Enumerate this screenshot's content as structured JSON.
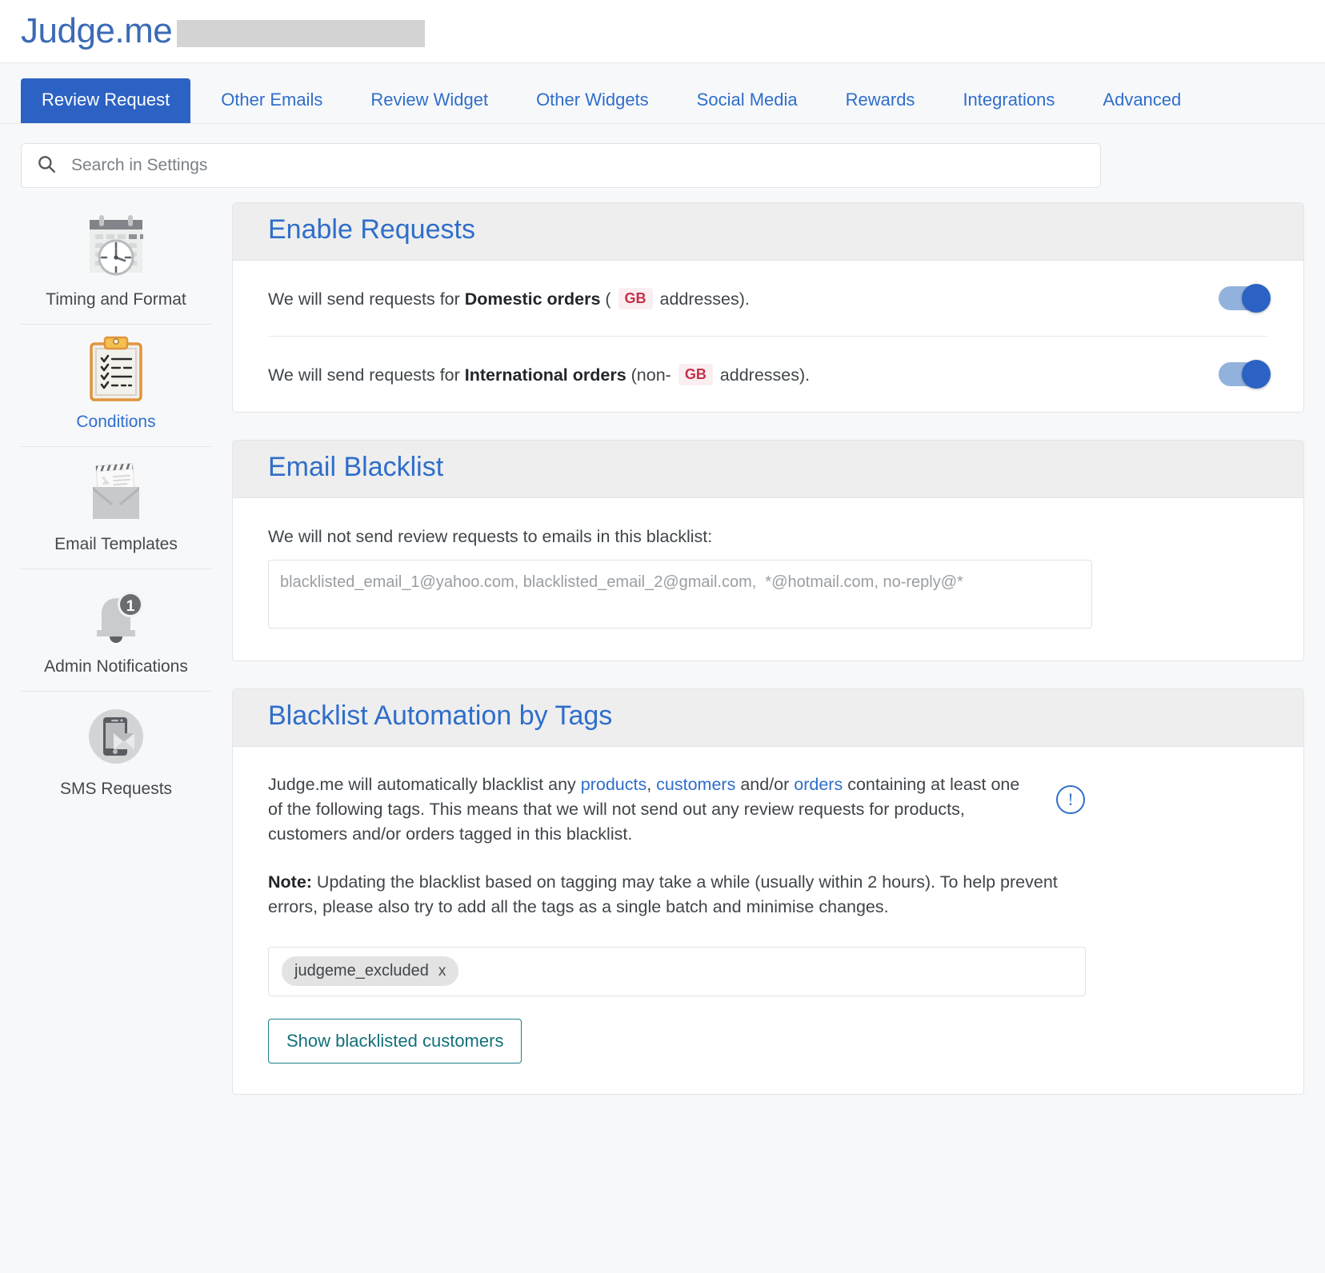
{
  "brand": {
    "logo_text": "Judge.me",
    "logo_color": "#3c6bb5"
  },
  "tabs": [
    {
      "label": "Review Request",
      "active": true
    },
    {
      "label": "Other Emails",
      "active": false
    },
    {
      "label": "Review Widget",
      "active": false
    },
    {
      "label": "Other Widgets",
      "active": false
    },
    {
      "label": "Social Media",
      "active": false
    },
    {
      "label": "Rewards",
      "active": false
    },
    {
      "label": "Integrations",
      "active": false
    },
    {
      "label": "Advanced",
      "active": false
    }
  ],
  "search": {
    "placeholder": "Search in Settings",
    "value": "",
    "icon": "search-icon"
  },
  "sidebar": {
    "items": [
      {
        "label": "Timing and Format",
        "icon": "calendar-clock-icon",
        "active": false
      },
      {
        "label": "Conditions",
        "icon": "clipboard-checklist-icon",
        "active": true
      },
      {
        "label": "Email Templates",
        "icon": "envelope-letter-icon",
        "active": false
      },
      {
        "label": "Admin Notifications",
        "icon": "bell-icon",
        "badge": "1",
        "active": false
      },
      {
        "label": "SMS Requests",
        "icon": "phone-message-icon",
        "active": false
      }
    ]
  },
  "enable_requests": {
    "title": "Enable Requests",
    "rows": [
      {
        "prefix": "We will send requests for ",
        "bold": "Domestic orders",
        "mid": " ( ",
        "badge": "GB",
        "suffix": " addresses).",
        "toggle_on": true
      },
      {
        "prefix": "We will send requests for ",
        "bold": "International orders",
        "mid": " (non- ",
        "badge": "GB",
        "suffix": " addresses).",
        "toggle_on": true
      }
    ]
  },
  "email_blacklist": {
    "title": "Email Blacklist",
    "label": "We will not send review requests to emails in this blacklist:",
    "textarea_value": "",
    "textarea_placeholder": "blacklisted_email_1@yahoo.com, blacklisted_email_2@gmail.com,  *@hotmail.com, no-reply@*"
  },
  "blacklist_tags": {
    "title": "Blacklist Automation by Tags",
    "para_1": "Judge.me will automatically blacklist any ",
    "link_products": "products",
    "para_comma": ", ",
    "link_customers": "customers",
    "para_2": " and/or ",
    "link_orders": "orders",
    "para_3": " containing at least one of the following tags. This means that we will not send out any review requests for products, customers and/or orders tagged in this blacklist.",
    "note_label": "Note:",
    "note_text": " Updating the blacklist based on tagging may take a while (usually within 2 hours). To help prevent errors, please also try to add all the tags as a single batch and minimise changes.",
    "info_icon": "!",
    "tags": [
      {
        "label": "judgeme_excluded",
        "remove": "x"
      }
    ],
    "show_blacklisted_button": "Show blacklisted customers"
  }
}
